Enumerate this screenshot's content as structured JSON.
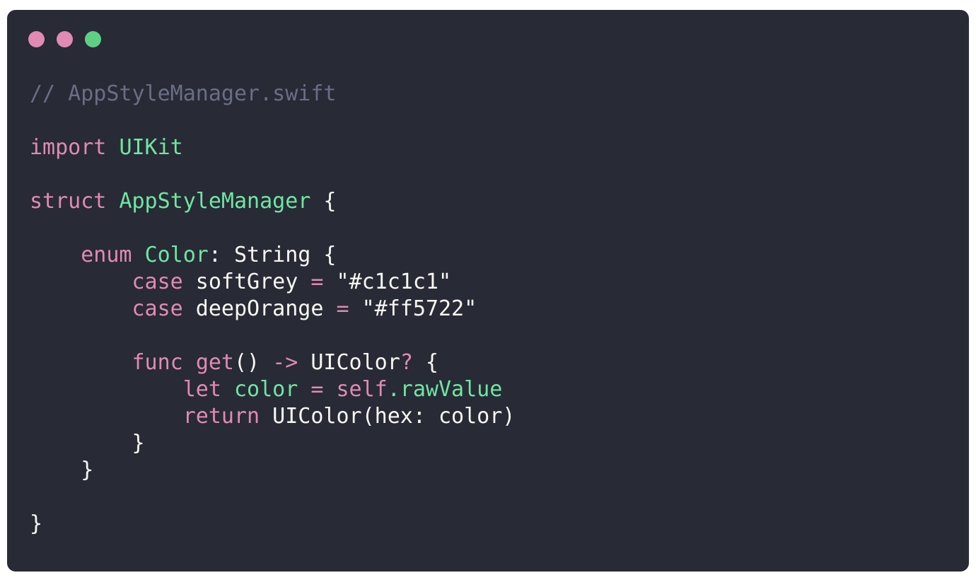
{
  "window": {
    "background": "#282a36",
    "buttons": [
      {
        "name": "close",
        "color": "#e08ab4"
      },
      {
        "name": "minimize",
        "color": "#e08ab4"
      },
      {
        "name": "zoom",
        "color": "#5fcf85"
      }
    ]
  },
  "code": {
    "lines": [
      [
        {
          "t": "comment",
          "v": "// AppStyleManager.swift"
        }
      ],
      [],
      [
        {
          "t": "keyword",
          "v": "import"
        },
        {
          "t": "plain",
          "v": " "
        },
        {
          "t": "type",
          "v": "UIKit"
        }
      ],
      [],
      [
        {
          "t": "keyword",
          "v": "struct"
        },
        {
          "t": "plain",
          "v": " "
        },
        {
          "t": "type",
          "v": "AppStyleManager"
        },
        {
          "t": "plain",
          "v": " {"
        }
      ],
      [],
      [
        {
          "t": "plain",
          "v": "    "
        },
        {
          "t": "keyword",
          "v": "enum"
        },
        {
          "t": "plain",
          "v": " "
        },
        {
          "t": "type",
          "v": "Color"
        },
        {
          "t": "plain",
          "v": ": String {"
        }
      ],
      [
        {
          "t": "plain",
          "v": "        "
        },
        {
          "t": "keyword",
          "v": "case"
        },
        {
          "t": "plain",
          "v": " softGrey "
        },
        {
          "t": "op",
          "v": "="
        },
        {
          "t": "plain",
          "v": " "
        },
        {
          "t": "string",
          "v": "\"#c1c1c1\""
        }
      ],
      [
        {
          "t": "plain",
          "v": "        "
        },
        {
          "t": "keyword",
          "v": "case"
        },
        {
          "t": "plain",
          "v": " deepOrange "
        },
        {
          "t": "op",
          "v": "="
        },
        {
          "t": "plain",
          "v": " "
        },
        {
          "t": "string",
          "v": "\"#ff5722\""
        }
      ],
      [],
      [
        {
          "t": "plain",
          "v": "        "
        },
        {
          "t": "keyword",
          "v": "func"
        },
        {
          "t": "plain",
          "v": " "
        },
        {
          "t": "keyword",
          "v": "get"
        },
        {
          "t": "plain",
          "v": "() "
        },
        {
          "t": "op",
          "v": "->"
        },
        {
          "t": "plain",
          "v": " UIColor"
        },
        {
          "t": "op",
          "v": "?"
        },
        {
          "t": "plain",
          "v": " {"
        }
      ],
      [
        {
          "t": "plain",
          "v": "            "
        },
        {
          "t": "keyword",
          "v": "let"
        },
        {
          "t": "plain",
          "v": " "
        },
        {
          "t": "type",
          "v": "color"
        },
        {
          "t": "plain",
          "v": " "
        },
        {
          "t": "op",
          "v": "="
        },
        {
          "t": "plain",
          "v": " "
        },
        {
          "t": "keyword",
          "v": "self"
        },
        {
          "t": "type",
          "v": ".rawValue"
        }
      ],
      [
        {
          "t": "plain",
          "v": "            "
        },
        {
          "t": "keyword",
          "v": "return"
        },
        {
          "t": "plain",
          "v": " UIColor(hex: color)"
        }
      ],
      [
        {
          "t": "plain",
          "v": "        }"
        }
      ],
      [
        {
          "t": "plain",
          "v": "    }"
        }
      ],
      [],
      [
        {
          "t": "plain",
          "v": "}"
        }
      ]
    ]
  }
}
